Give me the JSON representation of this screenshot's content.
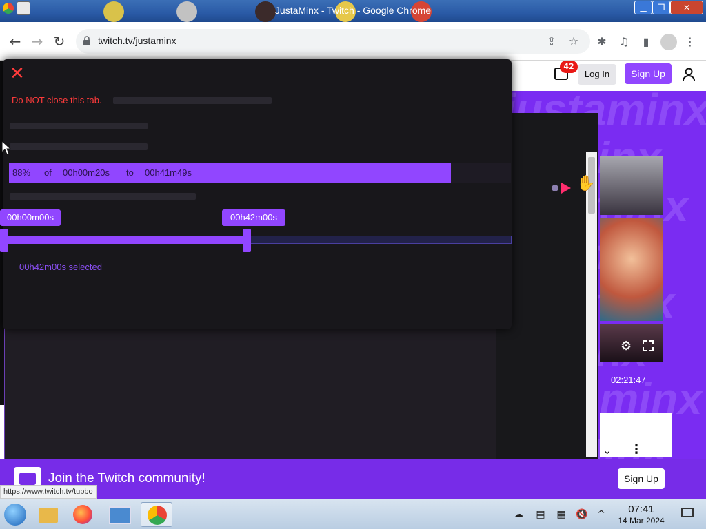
{
  "window": {
    "title": "JustaMinx - Twitch - Google Chrome",
    "minimize_glyph": "▁",
    "maximize_glyph": "❐",
    "close_glyph": "✕"
  },
  "browser": {
    "url": "twitch.tv/justaminx",
    "icons": [
      "back-icon",
      "forward-icon",
      "reload-icon",
      "lock-icon",
      "share-icon",
      "star-icon",
      "extensions-icon",
      "media-icon",
      "sidepanel-icon",
      "profile-icon",
      "menu-icon"
    ]
  },
  "twitch": {
    "notification_count": "42",
    "login_label": "Log In",
    "signup_label": "Sign Up",
    "watermark_text": "justaminx",
    "vod_duration": "02:21:47",
    "status_url": "https://www.twitch.tv/tubbo",
    "join_text": "Join the Twitch community!",
    "join_signup_label": "Sign Up"
  },
  "dialog": {
    "close_glyph": "✕",
    "warning": "Do NOT close this tab.",
    "progress": {
      "percent_value": 0.88,
      "percent": "88%",
      "of": "of",
      "current": "00h00m20s",
      "to": "to",
      "total": "00h41m49s"
    },
    "range": {
      "start_label": "00h00m00s",
      "end_label": "00h42m00s",
      "selected_text": "00h42m00s selected",
      "end_fraction": 0.48
    }
  },
  "taskbar": {
    "time": "07:41",
    "date": "14 Mar 2024",
    "apps": [
      "folder-icon",
      "firefox-icon",
      "monitor-icon",
      "chrome-icon"
    ]
  },
  "colors": {
    "twitch_purple": "#9146ff",
    "warning_red": "#ff3b3b",
    "banner_purple": "#772ce8"
  }
}
